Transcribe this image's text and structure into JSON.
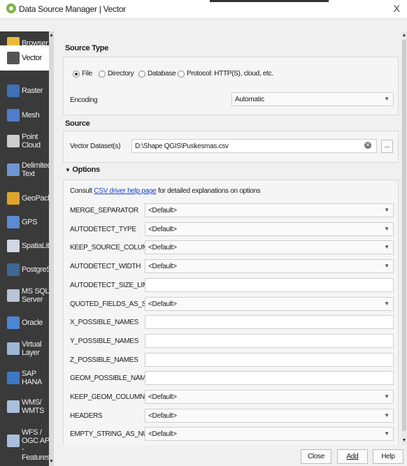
{
  "window": {
    "title": "Data Source Manager | Vector",
    "close": "X"
  },
  "sidebar": [
    {
      "label": "Browser",
      "icon": "folder-icon",
      "color": "#e8b93c"
    },
    {
      "label": "Vector",
      "icon": "vector-icon",
      "color": "#555555",
      "active": true
    },
    {
      "label": "Raster",
      "icon": "raster-icon",
      "color": "#3f6fb7"
    },
    {
      "label": "Mesh",
      "icon": "mesh-icon",
      "color": "#4f7dc9"
    },
    {
      "label": "Point\nCloud",
      "icon": "point-cloud-icon",
      "color": "#cccccc"
    },
    {
      "label": "Delimited\nText",
      "icon": "delimited-text-icon",
      "color": "#6f94d3"
    },
    {
      "label": "GeoPackag",
      "icon": "geopackage-icon",
      "color": "#e0a32b"
    },
    {
      "label": "GPS",
      "icon": "gps-icon",
      "color": "#5b8bd1"
    },
    {
      "label": "SpatiaLite",
      "icon": "spatialite-icon",
      "color": "#cfd8e3"
    },
    {
      "label": "PostgreSQ",
      "icon": "postgresql-icon",
      "color": "#3e6795"
    },
    {
      "label": "MS SQL\nServer",
      "icon": "mssql-icon",
      "color": "#b6c4d6"
    },
    {
      "label": "Oracle",
      "icon": "oracle-icon",
      "color": "#4c86d6"
    },
    {
      "label": "Virtual\nLayer",
      "icon": "virtual-layer-icon",
      "color": "#9fb6d6"
    },
    {
      "label": "SAP\nHANA",
      "icon": "sap-hana-icon",
      "color": "#3b79c6"
    },
    {
      "label": "WMS/\nWMTS",
      "icon": "wms-icon",
      "color": "#a9bfdb"
    },
    {
      "label": "WFS /\nOGC API -\nFeatures",
      "icon": "wfs-icon",
      "color": "#a9bfdb"
    }
  ],
  "source_type": {
    "heading": "Source Type",
    "options": [
      "File",
      "Directory",
      "Database",
      "Protocol: HTTP(S), cloud, etc."
    ],
    "selected": "File",
    "encoding_label": "Encoding",
    "encoding_value": "Automatic"
  },
  "source": {
    "heading": "Source",
    "dataset_label": "Vector Dataset(s)",
    "dataset_value": "D:\\Shape QGIS\\Puskesmas.csv",
    "browse_label": "..."
  },
  "options": {
    "heading": "Options",
    "consult_prefix": "Consult",
    "consult_link": "CSV driver help page",
    "consult_suffix": "for detailed explanations on options",
    "rows": [
      {
        "name": "MERGE_SEPARATOR",
        "type": "combo",
        "value": "<Default>"
      },
      {
        "name": "AUTODETECT_TYPE",
        "type": "combo",
        "value": "<Default>"
      },
      {
        "name": "KEEP_SOURCE_COLUMNS",
        "type": "combo",
        "value": "<Default>"
      },
      {
        "name": "AUTODETECT_WIDTH",
        "type": "combo",
        "value": "<Default>"
      },
      {
        "name": "AUTODETECT_SIZE_LIMIT",
        "type": "text",
        "value": ""
      },
      {
        "name": "QUOTED_FIELDS_AS_STRING",
        "type": "combo",
        "value": "<Default>"
      },
      {
        "name": "X_POSSIBLE_NAMES",
        "type": "text",
        "value": ""
      },
      {
        "name": "Y_POSSIBLE_NAMES",
        "type": "text",
        "value": ""
      },
      {
        "name": "Z_POSSIBLE_NAMES",
        "type": "text",
        "value": ""
      },
      {
        "name": "GEOM_POSSIBLE_NAMES",
        "type": "text",
        "value": ""
      },
      {
        "name": "KEEP_GEOM_COLUMNS",
        "type": "combo",
        "value": "<Default>"
      },
      {
        "name": "HEADERS",
        "type": "combo",
        "value": "<Default>"
      },
      {
        "name": "EMPTY_STRING_AS_NULL",
        "type": "combo",
        "value": "<Default>"
      }
    ]
  },
  "footer": {
    "close": "Close",
    "add": "Add",
    "help": "Help"
  }
}
